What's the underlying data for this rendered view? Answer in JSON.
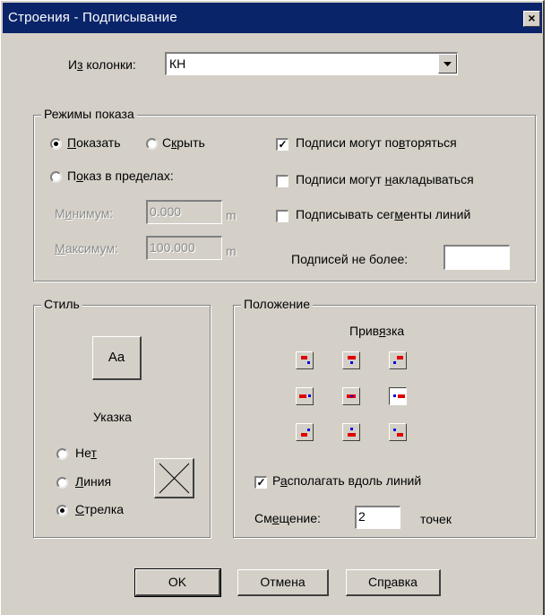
{
  "window": {
    "title": "Строения - Подписывание",
    "close_glyph": "×"
  },
  "column": {
    "label_pre": "И",
    "label_u": "з",
    "label_post": " колонки:",
    "value": "КН"
  },
  "display_modes": {
    "title": "Режимы показа",
    "show": {
      "u": "П",
      "rest": "оказать",
      "selected": true
    },
    "hide": {
      "pre": "С",
      "u": "к",
      "rest": "рыть",
      "selected": false
    },
    "range": {
      "pre": "П",
      "u": "о",
      "rest": "каз в пределах:",
      "selected": false
    },
    "min": {
      "pre": "М",
      "u": "и",
      "rest": "нимум:",
      "value": "0.000",
      "unit": "m"
    },
    "max": {
      "u": "М",
      "rest": "аксимум:",
      "value": "100.000",
      "unit": "m"
    },
    "repeat": {
      "pre": "Подписи могут по",
      "u": "в",
      "rest": "торяться",
      "checked": true
    },
    "overlap": {
      "pre": "Подписи могут ",
      "u": "н",
      "rest": "акладываться",
      "checked": false
    },
    "segments": {
      "pre": "Подписывать сег",
      "u": "м",
      "rest": "енты линий",
      "checked": false
    },
    "limit": {
      "pre": "По",
      "u": "д",
      "rest": "писей не более:",
      "value": ""
    }
  },
  "style": {
    "title": "Стиль",
    "font_button": "Aa",
    "pointer_title": "Указка",
    "none": {
      "pre": "Не",
      "u": "т",
      "selected": false
    },
    "line": {
      "u": "Л",
      "rest": "иния",
      "selected": false
    },
    "arrow": {
      "u": "С",
      "rest": "трелка",
      "selected": true
    }
  },
  "position": {
    "title": "Положение",
    "anchor": {
      "pre": "Прив",
      "u": "я",
      "rest": "зка",
      "selected_index": 5
    },
    "along": {
      "pre": "Р",
      "u": "а",
      "rest": "сполагать вдоль линий",
      "checked": true
    },
    "offset": {
      "pre": "См",
      "u": "е",
      "rest": "щение:",
      "value": "2",
      "unit": "точек"
    }
  },
  "buttons": {
    "ok": "OK",
    "cancel": "Отмена",
    "help": {
      "pre": "Сп",
      "u": "р",
      "rest": "авка"
    }
  },
  "colors": {
    "title_bg": "#0a246a",
    "face": "#d4d0c8",
    "marker_red": "#e00000",
    "marker_blue": "#0000e0"
  }
}
